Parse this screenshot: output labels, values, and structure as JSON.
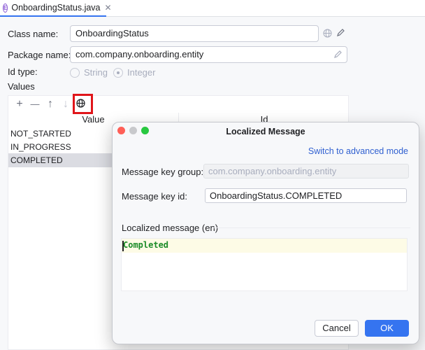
{
  "tab": {
    "icon": "enum-icon",
    "icon_letter": "E",
    "label": "OnboardingStatus.java",
    "close": "✕"
  },
  "form": {
    "class_name_label": "Class name:",
    "class_name_value": "OnboardingStatus",
    "package_name_label": "Package name:",
    "package_name_value": "com.company.onboarding.entity",
    "id_type_label": "Id type:",
    "id_type_options": [
      "String",
      "Integer"
    ],
    "id_type_selected": "Integer",
    "values_label": "Values"
  },
  "values_toolbar": {
    "add": "+",
    "remove": "—",
    "move_up": "↑",
    "move_down": "↓"
  },
  "values_table": {
    "columns": [
      "Value",
      "Id"
    ],
    "rows": [
      "NOT_STARTED",
      "IN_PROGRESS",
      "COMPLETED"
    ],
    "selected": "COMPLETED"
  },
  "dialog": {
    "title": "Localized Message",
    "advanced_link": "Switch to advanced mode",
    "group_label": "Message key group:",
    "group_value": "com.company.onboarding.entity",
    "key_id_label": "Message key id:",
    "key_id_value": "OnboardingStatus.COMPLETED",
    "section_label": "Localized message (en)",
    "message_text": "Completed",
    "cancel": "Cancel",
    "ok": "OK"
  },
  "colors": {
    "accent": "#3574f0",
    "highlight": "#e0151a",
    "link": "#2f5fd0",
    "code_green": "#1a8b27"
  }
}
